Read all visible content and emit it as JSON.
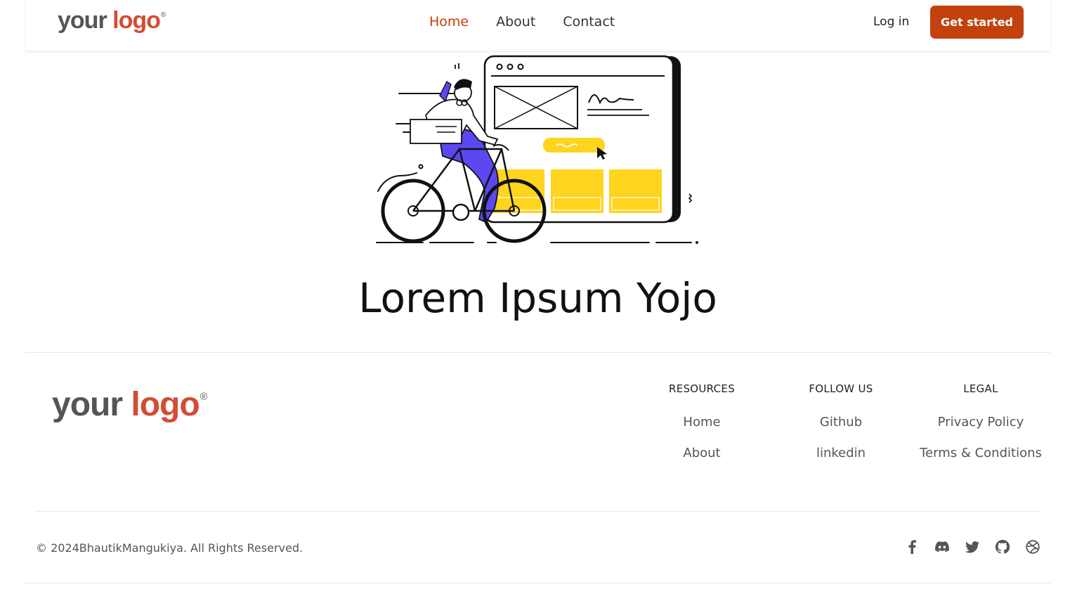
{
  "header": {
    "logo": {
      "word1": "your",
      "word2": "logo",
      "mark": "®"
    },
    "nav": [
      {
        "label": "Home",
        "active": true
      },
      {
        "label": "About",
        "active": false
      },
      {
        "label": "Contact",
        "active": false
      }
    ],
    "login_label": "Log in",
    "cta_label": "Get started"
  },
  "hero": {
    "illustration": "cyclist-with-website-wireframe",
    "title": "Lorem Ipsum Yojo"
  },
  "footer": {
    "logo": {
      "word1": "your",
      "word2": "logo",
      "mark": "®"
    },
    "columns": [
      {
        "title": "RESOURCES",
        "links": [
          "Home",
          "About"
        ]
      },
      {
        "title": "FOLLOW US",
        "links": [
          "Github",
          "linkedin"
        ]
      },
      {
        "title": "LEGAL",
        "links": [
          "Privacy Policy",
          "Terms & Conditions"
        ]
      }
    ],
    "copyright": "© 2024BhautikMangukiya. All Rights Reserved.",
    "social_icons": [
      "facebook-icon",
      "discord-icon",
      "twitter-icon",
      "github-icon",
      "dribbble-icon"
    ]
  },
  "colors": {
    "accent": "#c2410c",
    "logo_gray": "#555555",
    "logo_red": "#d24d33",
    "illustration_yellow": "#ffd41f",
    "illustration_purple": "#5b48f0"
  }
}
